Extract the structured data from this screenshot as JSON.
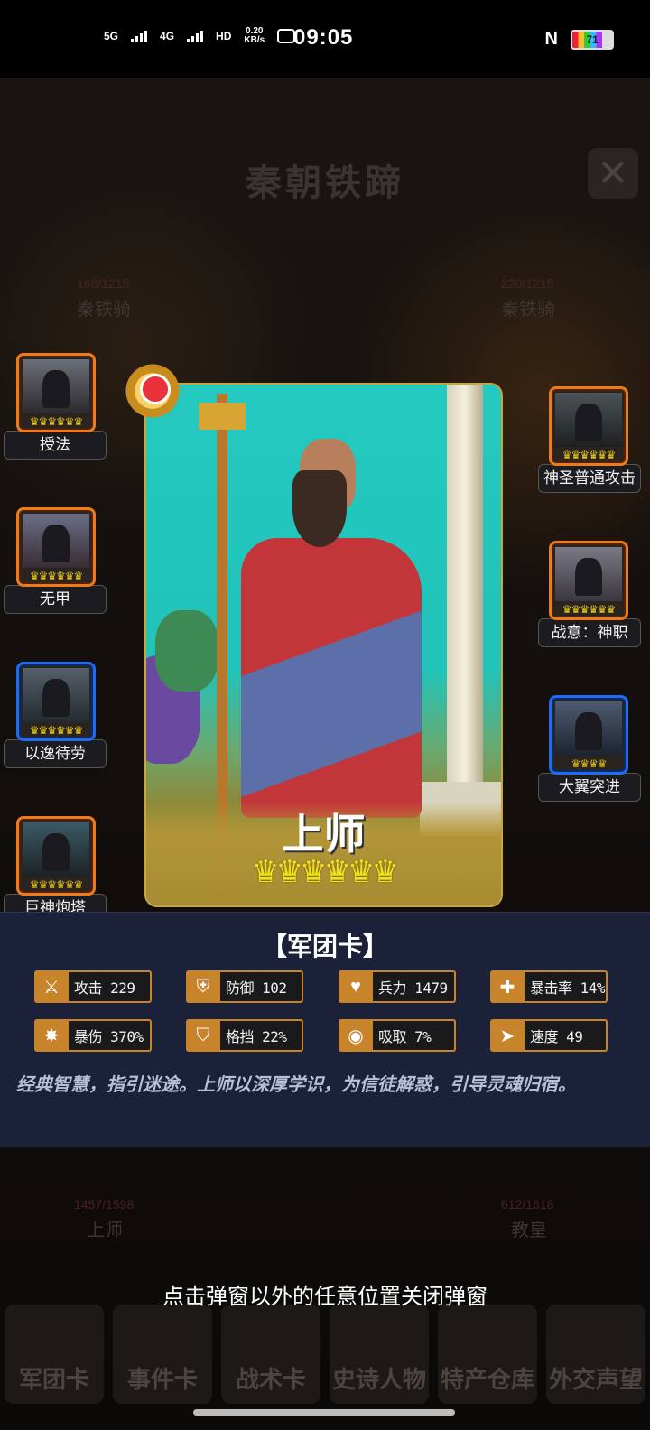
{
  "status_bar": {
    "network_1": "5G",
    "network_2": "4G",
    "hd_label": "HD",
    "net_speed": "0.20",
    "net_unit": "KB/s",
    "time": "09:05",
    "nfc": "N",
    "battery": "71"
  },
  "background": {
    "title": "秦朝铁蹄",
    "close_icon": "close-icon",
    "left_hp": "168/1215",
    "left_unit": "秦铁骑",
    "right_hp": "220/1215",
    "right_unit": "秦铁骑",
    "bottom_left_hp": "1457/1598",
    "bottom_left_unit": "上师",
    "bottom_right_hp": "612/1618",
    "bottom_right_unit": "教皇",
    "nav": [
      "军团卡",
      "事件卡",
      "战术卡",
      "史诗人物",
      "特产仓库",
      "外交声望"
    ]
  },
  "skills_left": [
    {
      "label": "授法",
      "crowns": "♛♛♛♛♛♛",
      "frame": "orange"
    },
    {
      "label": "无甲",
      "crowns": "♛♛♛♛♛♛",
      "frame": "orange"
    },
    {
      "label": "以逸待劳",
      "crowns": "♛♛♛♛♛♛",
      "frame": "blue"
    },
    {
      "label": "巨神炮塔",
      "crowns": "♛♛♛♛♛♛",
      "frame": "orange"
    }
  ],
  "skills_right": [
    {
      "label": "神圣普通攻击",
      "crowns": "♛♛♛♛♛♛",
      "frame": "orange"
    },
    {
      "label": "战意：神职",
      "crowns": "♛♛♛♛♛♛",
      "frame": "orange"
    },
    {
      "label": "大翼突进",
      "crowns": "♛♛♛♛",
      "frame": "blue"
    }
  ],
  "card": {
    "name": "上师",
    "crowns": "♛♛♛♛♛♛",
    "rank_icon": "rank-badge-icon"
  },
  "panel": {
    "title": "【军团卡】",
    "stats": [
      {
        "icon": "sword-icon",
        "text": "攻击 229"
      },
      {
        "icon": "shield-icon",
        "text": "防御 102"
      },
      {
        "icon": "heart-icon",
        "text": "兵力 1479"
      },
      {
        "icon": "crit-icon",
        "text": "暴击率 14%"
      },
      {
        "icon": "crit-damage-icon",
        "text": "暴伤 370%"
      },
      {
        "icon": "block-icon",
        "text": "格挡 22%"
      },
      {
        "icon": "absorb-icon",
        "text": "吸取 7%"
      },
      {
        "icon": "speed-icon",
        "text": "速度 49"
      }
    ],
    "description": "经典智慧，指引迷途。上师以深厚学识，为信徒解惑，引导灵魂归宿。"
  },
  "hint": "点击弹窗以外的任意位置关闭弹窗"
}
